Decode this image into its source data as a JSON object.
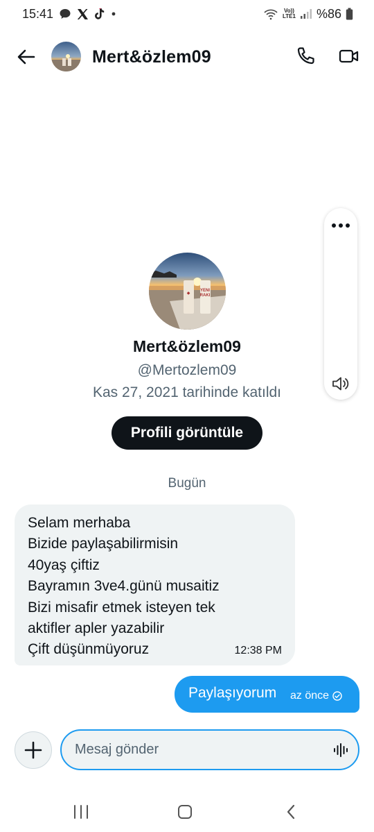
{
  "status_bar": {
    "time": "15:41",
    "battery": "%86",
    "notification_icons": [
      "chat-bubble-icon",
      "x-logo-icon",
      "tiktok-icon",
      "dot-icon"
    ],
    "network_top": "Vo))",
    "network_bottom": "LTE1"
  },
  "header": {
    "title": "Mert&özlem09"
  },
  "profile": {
    "name": "Mert&özlem09",
    "handle": "@Mertozlem09",
    "joined": "Kas 27, 2021 tarihinde katıldı",
    "view_button": "Profili görüntüle"
  },
  "conversation": {
    "date_separator": "Bugün",
    "incoming": {
      "lines": [
        "Selam merhaba",
        "Bizide paylaşabilirmisin",
        "40yaş çiftiz",
        "Bayramın 3ve4.günü musaitiz",
        "Bizi misafir etmek isteyen tek",
        "aktifler apler yazabilir",
        "Çift düşünmüyoruz"
      ],
      "time": "12:38 PM"
    },
    "outgoing": {
      "text": "Paylaşıyorum",
      "status": "az önce"
    }
  },
  "composer": {
    "placeholder": "Mesaj gönder"
  },
  "colors": {
    "accent": "#1d9bf0",
    "bubble_incoming": "#eff3f4",
    "text_primary": "#0f1419",
    "text_secondary": "#536471"
  }
}
